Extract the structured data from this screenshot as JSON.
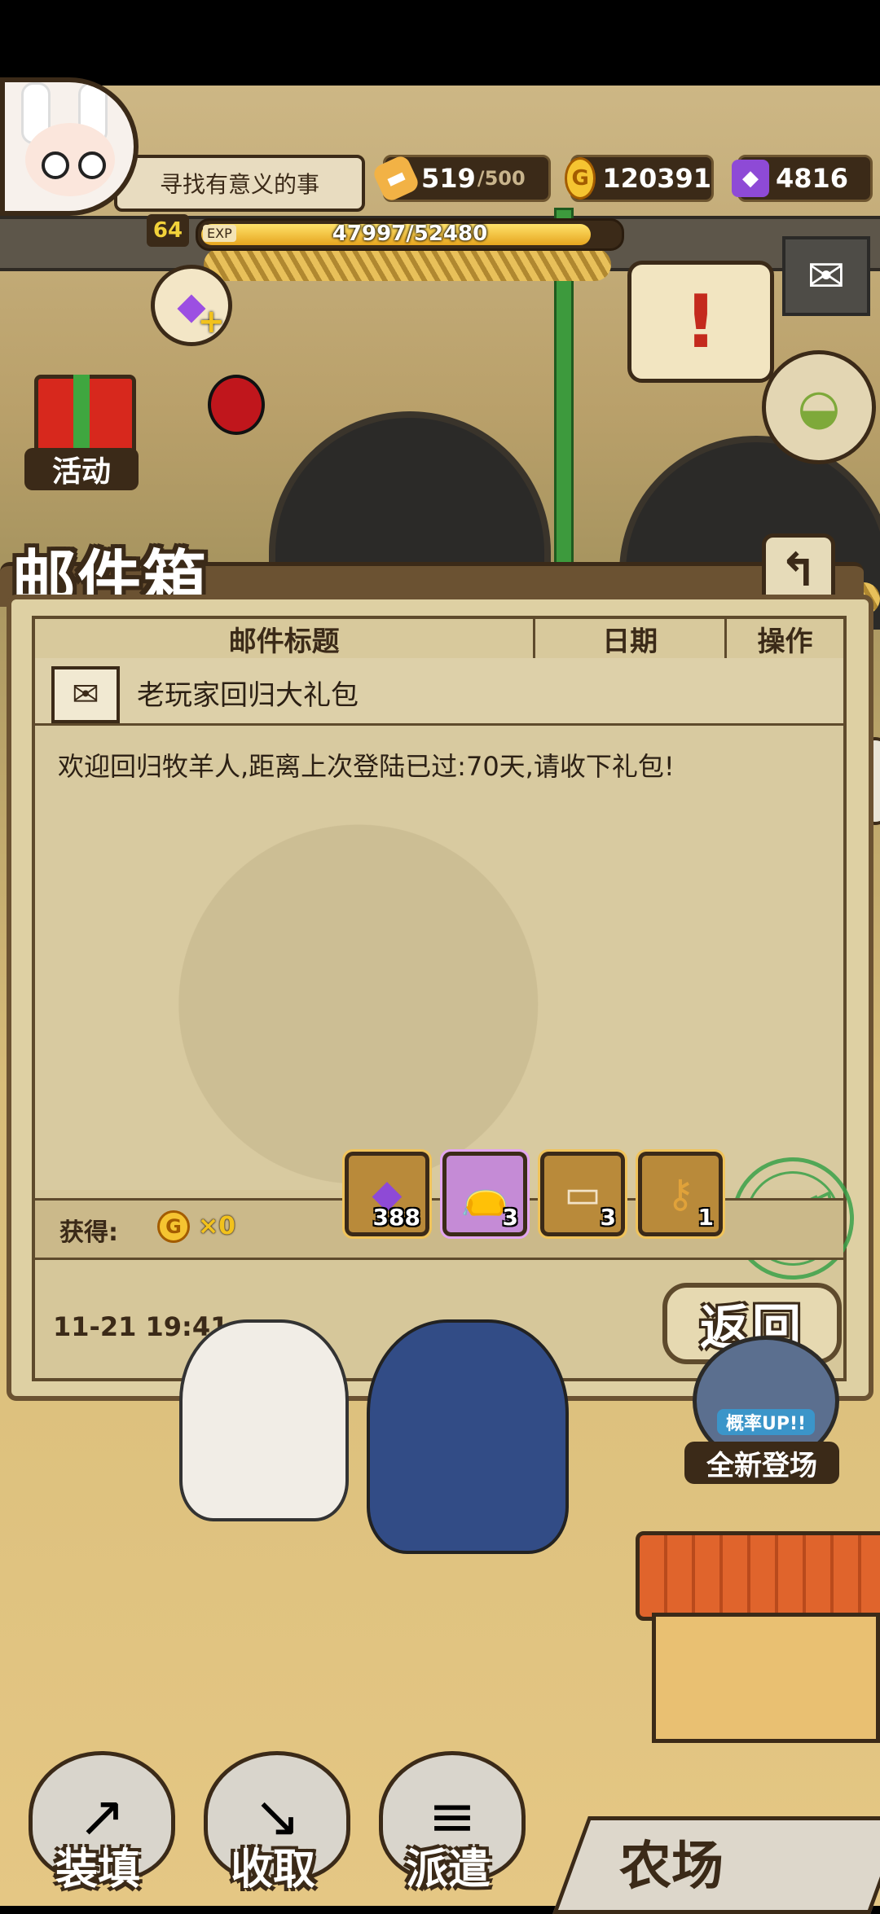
{
  "player": {
    "name": "寻找有意义的事",
    "level": "64",
    "exp_tag": "EXP",
    "exp_text": "47997/52480",
    "exp_progress": 0.915
  },
  "resources": {
    "stamina_value": "519",
    "stamina_max": "/500",
    "gold": "120391",
    "gems": "4816"
  },
  "hud": {
    "activity_label": "活动"
  },
  "mailbox": {
    "title": "邮件箱",
    "columns": [
      "邮件标题",
      "日期",
      "操作"
    ],
    "subject": "老玩家回归大礼包",
    "body": "欢迎回归牧羊人,距离上次登陆已过:70天,请收下礼包!",
    "stamp_text": "已领取",
    "obtain_label": "获得:",
    "coin_count": "×0",
    "rewards": [
      {
        "icon": "gem-icon",
        "qty": "388",
        "glyph": "◆",
        "color": "#8e4ad6",
        "frame": "gold"
      },
      {
        "icon": "money-bag-icon",
        "qty": "3",
        "glyph": "👝",
        "color": "#d6b070",
        "frame": "purple"
      },
      {
        "icon": "ticket-icon",
        "qty": "3",
        "glyph": "▭",
        "color": "#f2e3c7",
        "frame": "gold"
      },
      {
        "icon": "key-icon",
        "qty": "1",
        "glyph": "⚷",
        "color": "#e0a23a",
        "frame": "gold"
      }
    ],
    "date": "11-21 19:41",
    "return_label": "返回"
  },
  "gacha": {
    "tag_top": "概率UP!!",
    "tag_bottom": "全新登场"
  },
  "nav": {
    "load_label": "装填",
    "collect_label": "收取",
    "dispatch_label": "派遣",
    "farm_label": "农场"
  },
  "colors": {
    "frame_brown": "#3b2a18",
    "panel_bg": "#d6c79a",
    "stamp_green": "#3aa24a",
    "coin_gold": "#f5c431",
    "gem_purple": "#8e4ad6"
  }
}
